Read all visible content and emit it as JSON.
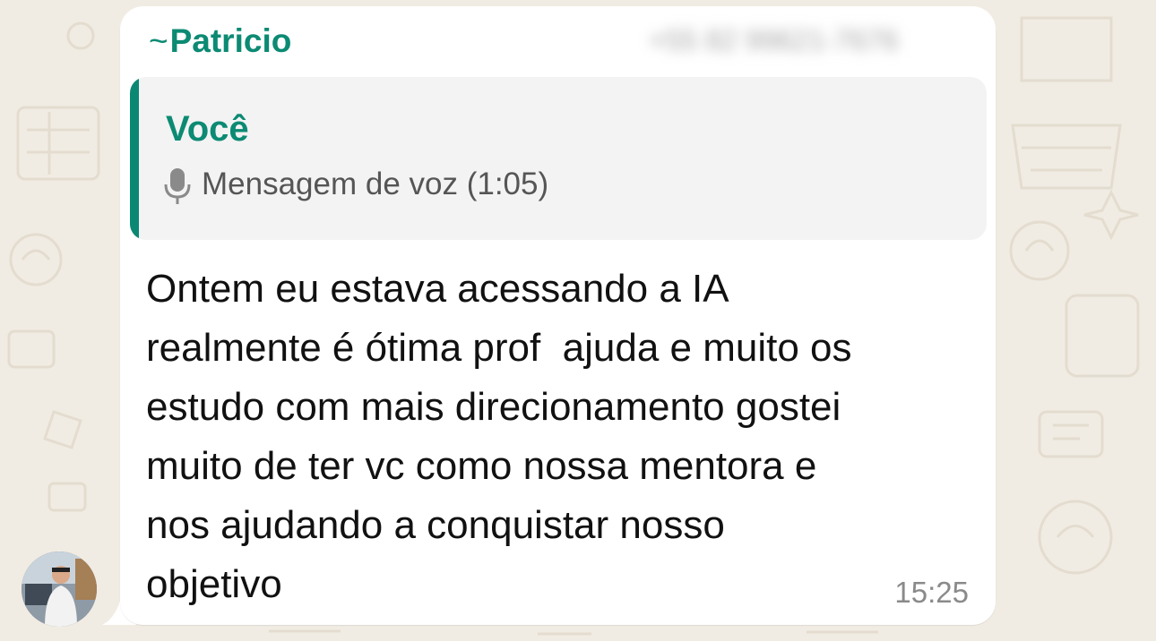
{
  "chat": {
    "background_color": "#f1ece3",
    "accent_color": "#0c8a73"
  },
  "message": {
    "sender_prefix": "~",
    "sender_name": "Patricio",
    "sender_phone_obscured": "+55 82 99621-7676",
    "quoted": {
      "author": "Você",
      "icon": "mic-icon",
      "text": "Mensagem de voz (1:05)"
    },
    "body_lines": [
      "Ontem eu estava acessando a IA",
      "realmente é ótima prof  ajuda e muito os",
      "estudo com mais direcionamento gostei",
      "muito de ter vc como nossa mentora e",
      "nos ajudando a conquistar nosso",
      "objetivo"
    ],
    "time": "15:25"
  }
}
